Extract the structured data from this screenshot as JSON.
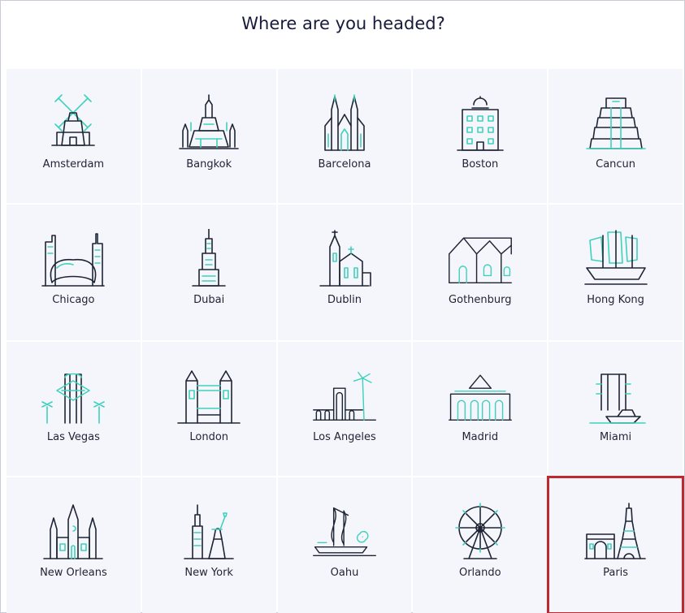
{
  "page": {
    "title": "Where are you headed?"
  },
  "destinations": [
    {
      "name": "Amsterdam",
      "icon": "windmill-icon"
    },
    {
      "name": "Bangkok",
      "icon": "temple-icon"
    },
    {
      "name": "Barcelona",
      "icon": "cathedral-icon"
    },
    {
      "name": "Boston",
      "icon": "state-house-icon"
    },
    {
      "name": "Cancun",
      "icon": "pyramid-icon"
    },
    {
      "name": "Chicago",
      "icon": "bean-skyline-icon"
    },
    {
      "name": "Dubai",
      "icon": "skyscraper-icon"
    },
    {
      "name": "Dublin",
      "icon": "church-icon"
    },
    {
      "name": "Gothenburg",
      "icon": "gabled-houses-icon"
    },
    {
      "name": "Hong Kong",
      "icon": "junk-boat-icon"
    },
    {
      "name": "Las Vegas",
      "icon": "vegas-sign-icon"
    },
    {
      "name": "London",
      "icon": "tower-bridge-icon"
    },
    {
      "name": "Los Angeles",
      "icon": "palm-arch-icon"
    },
    {
      "name": "Madrid",
      "icon": "palace-icon"
    },
    {
      "name": "Miami",
      "icon": "beach-tower-icon"
    },
    {
      "name": "New Orleans",
      "icon": "cathedral-spires-icon"
    },
    {
      "name": "New York",
      "icon": "statue-of-liberty-icon"
    },
    {
      "name": "Oahu",
      "icon": "canoe-icon"
    },
    {
      "name": "Orlando",
      "icon": "ferris-wheel-icon"
    },
    {
      "name": "Paris",
      "icon": "eiffel-tower-icon"
    }
  ],
  "selected": "Paris",
  "colors": {
    "accent": "#3fd1bd",
    "outline": "#1d2433",
    "tile": "#f5f6fc",
    "selection": "#c0282d"
  }
}
